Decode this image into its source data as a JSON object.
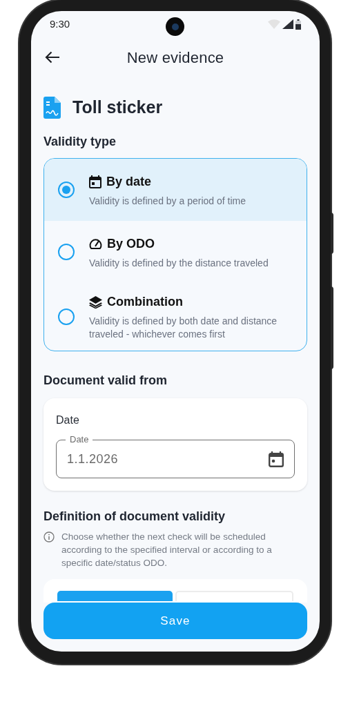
{
  "status_bar": {
    "time": "9:30"
  },
  "header": {
    "title": "New evidence"
  },
  "document": {
    "title": "Toll sticker"
  },
  "validity_type": {
    "heading": "Validity type",
    "options": [
      {
        "kind": "date",
        "label": "By date",
        "description": "Validity is defined by a period of time",
        "selected": true
      },
      {
        "kind": "odo",
        "label": "By ODO",
        "description": "Validity is defined by the distance traveled",
        "selected": false
      },
      {
        "kind": "combination",
        "label": "Combination",
        "description": "Validity is defined by both date and distance traveled - whichever comes first",
        "selected": false
      }
    ]
  },
  "valid_from": {
    "heading": "Document valid from",
    "card_label": "Date",
    "field": {
      "label": "Date",
      "value": "1.1.2026"
    }
  },
  "definition": {
    "heading": "Definition of document validity",
    "info": "Choose whether the next check will be scheduled according to the specified interval or according to a specific date/status ODO.",
    "tabs": [
      {
        "selected": true
      },
      {
        "selected": false
      }
    ]
  },
  "save_button": "Save"
}
